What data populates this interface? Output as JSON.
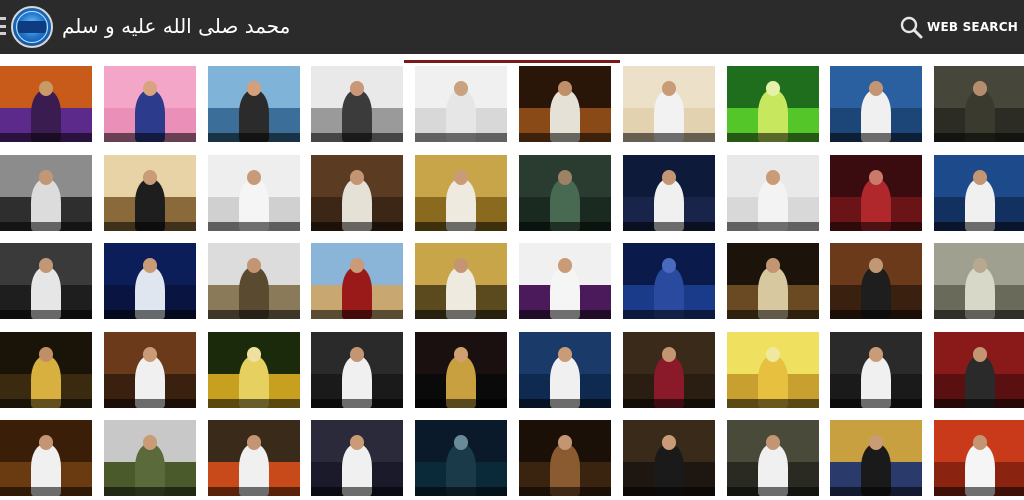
{
  "appbar": {
    "title": "محمد صلى الله عليه و سلم",
    "menu_icon": "menu-icon",
    "logo_icon": "app-logo",
    "search_icon": "search-icon",
    "search_label": "WEB SEARCH",
    "background": "#2b2b2b"
  },
  "accent_color": "#7b1a1a",
  "thumbnails": [
    {
      "sky": "#c85b1a",
      "ground": "#5b2a8a",
      "figure": "#3a1c50",
      "head": "#c79a66"
    },
    {
      "sky": "#f3a6c8",
      "ground": "#e98fb8",
      "figure": "#2d3b8c",
      "head": "#d8a47e"
    },
    {
      "sky": "#7fb3d8",
      "ground": "#3b6f9a",
      "figure": "#2b2b2b",
      "head": "#d3a07a"
    },
    {
      "sky": "#e9e9e9",
      "ground": "#9a9a9a",
      "figure": "#3b3b3b",
      "head": "#c89878"
    },
    {
      "sky": "#f0f0f0",
      "ground": "#d8d8d8",
      "figure": "#e6e6e6",
      "head": "#c9a27f"
    },
    {
      "sky": "#2a1608",
      "ground": "#8a4a18",
      "figure": "#e6e1d6",
      "head": "#c08f68"
    },
    {
      "sky": "#ece1c8",
      "ground": "#e3d2b0",
      "figure": "#f2f2f2",
      "head": "#c99b76"
    },
    {
      "sky": "#1e6e1e",
      "ground": "#55c62a",
      "figure": "#c7e85e",
      "head": "#e7f0a8"
    },
    {
      "sky": "#2a5fa0",
      "ground": "#1d4678",
      "figure": "#f0f0f0",
      "head": "#c49572"
    },
    {
      "sky": "#46463a",
      "ground": "#2c2c24",
      "figure": "#3a3a2e",
      "head": "#b58d6e"
    },
    {
      "sky": "#8c8c8c",
      "ground": "#2e2e2e",
      "figure": "#dcdcdc",
      "head": "#c29775"
    },
    {
      "sky": "#e7d3a6",
      "ground": "#8a6a3a",
      "figure": "#1e1e1e",
      "head": "#c99b76"
    },
    {
      "sky": "#eeeeee",
      "ground": "#d0d0d0",
      "figure": "#f5f5f5",
      "head": "#c79b7a"
    },
    {
      "sky": "#5b3b22",
      "ground": "#3c2616",
      "figure": "#e6e1d6",
      "head": "#c49572"
    },
    {
      "sky": "#c9a54a",
      "ground": "#8a6a1e",
      "figure": "#eeeae0",
      "head": "#c99b76"
    },
    {
      "sky": "#2a3b30",
      "ground": "#1a2a20",
      "figure": "#486a52",
      "head": "#9d8266"
    },
    {
      "sky": "#0e1a3a",
      "ground": "#18244a",
      "figure": "#f0f0f0",
      "head": "#c49572"
    },
    {
      "sky": "#e9e9e9",
      "ground": "#d8d8d8",
      "figure": "#f3f3f3",
      "head": "#c99b76"
    },
    {
      "sky": "#3a0c10",
      "ground": "#6a1418",
      "figure": "#b0282c",
      "head": "#c97a6a"
    },
    {
      "sky": "#1c4a8a",
      "ground": "#123060",
      "figure": "#f0f0f0",
      "head": "#c49572"
    },
    {
      "sky": "#3a3a3a",
      "ground": "#1e1e1e",
      "figure": "#e6e6e6",
      "head": "#c29775"
    },
    {
      "sky": "#0c1e5a",
      "ground": "#0a1440",
      "figure": "#dfe6f0",
      "head": "#c99b76"
    },
    {
      "sky": "#dcdcdc",
      "ground": "#8a7a5a",
      "figure": "#5a4a30",
      "head": "#c49572"
    },
    {
      "sky": "#8ab4d8",
      "ground": "#c8a870",
      "figure": "#9a1a1a",
      "head": "#c99b76"
    },
    {
      "sky": "#c9a54a",
      "ground": "#5a4a1e",
      "figure": "#eeeae0",
      "head": "#c49572"
    },
    {
      "sky": "#f0f0f0",
      "ground": "#4a1a5a",
      "figure": "#f5f5f5",
      "head": "#c99b76"
    },
    {
      "sky": "#0a1a4a",
      "ground": "#1a3a8a",
      "figure": "#2a4aa0",
      "head": "#4a6ac0"
    },
    {
      "sky": "#1c140a",
      "ground": "#6a4a22",
      "figure": "#d8c8a0",
      "head": "#c49572"
    },
    {
      "sky": "#6a3a1a",
      "ground": "#3a200e",
      "figure": "#1e1e1e",
      "head": "#c29775"
    },
    {
      "sky": "#a0a090",
      "ground": "#6a6a5a",
      "figure": "#d8d8c8",
      "head": "#b8a890"
    },
    {
      "sky": "#1a1408",
      "ground": "#3a2a10",
      "figure": "#d8b040",
      "head": "#c08f68"
    },
    {
      "sky": "#6a3a1a",
      "ground": "#3a200e",
      "figure": "#f0f0f0",
      "head": "#c99b76"
    },
    {
      "sky": "#1a2a0a",
      "ground": "#c8a020",
      "figure": "#e6d060",
      "head": "#f0e0a0"
    },
    {
      "sky": "#2a2a2a",
      "ground": "#1a1a1a",
      "figure": "#f0f0f0",
      "head": "#c49572"
    },
    {
      "sky": "#1a1010",
      "ground": "#0a0a0a",
      "figure": "#c8a040",
      "head": "#d0a070"
    },
    {
      "sky": "#1a3a6a",
      "ground": "#0e2a50",
      "figure": "#f0f0f0",
      "head": "#c99b76"
    },
    {
      "sky": "#3a2a1a",
      "ground": "#2a1e12",
      "figure": "#8a1a2a",
      "head": "#c49572"
    },
    {
      "sky": "#f0e060",
      "ground": "#c8a030",
      "figure": "#e8c040",
      "head": "#f0e8a0"
    },
    {
      "sky": "#2a2a2a",
      "ground": "#1a1a1a",
      "figure": "#f0f0f0",
      "head": "#c99b76"
    },
    {
      "sky": "#8a1a1a",
      "ground": "#5a1010",
      "figure": "#2a2a2a",
      "head": "#c49572"
    },
    {
      "sky": "#3a1e08",
      "ground": "#6a3a10",
      "figure": "#f0f0f0",
      "head": "#c49572"
    },
    {
      "sky": "#c8c8c8",
      "ground": "#4a5a2a",
      "figure": "#5a6a3a",
      "head": "#c99b76"
    },
    {
      "sky": "#3a2a1a",
      "ground": "#c84a1a",
      "figure": "#f0f0f0",
      "head": "#c49572"
    },
    {
      "sky": "#2a2a3a",
      "ground": "#1a1a2a",
      "figure": "#f0f0f0",
      "head": "#c99b76"
    },
    {
      "sky": "#0a1a2a",
      "ground": "#0a2a3a",
      "figure": "#1a3a4a",
      "head": "#6a8a9a"
    },
    {
      "sky": "#1a1008",
      "ground": "#3a2410",
      "figure": "#8a5a30",
      "head": "#c49572"
    },
    {
      "sky": "#3a2a1a",
      "ground": "#1e1610",
      "figure": "#1a1a1a",
      "head": "#c99b76"
    },
    {
      "sky": "#4a4a3a",
      "ground": "#2a2a22",
      "figure": "#f0f0f0",
      "head": "#c49572"
    },
    {
      "sky": "#c8a040",
      "ground": "#2a3a6a",
      "figure": "#1a1a1a",
      "head": "#c99b76"
    },
    {
      "sky": "#c83a1a",
      "ground": "#8a2410",
      "figure": "#f5f5f5",
      "head": "#c49572"
    }
  ]
}
